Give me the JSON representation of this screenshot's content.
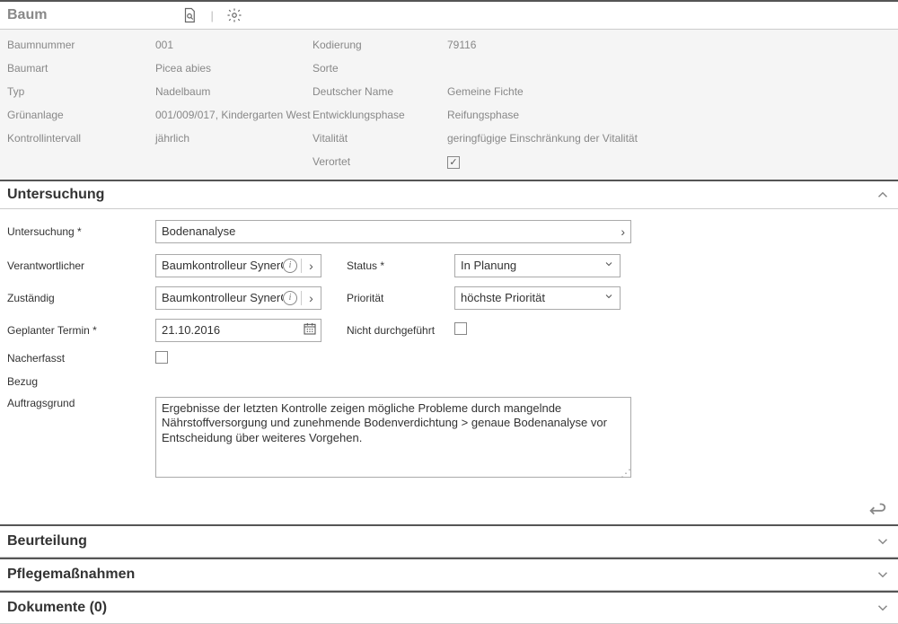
{
  "baum": {
    "title": "Baum",
    "fields": {
      "baumnummer_label": "Baumnummer",
      "baumnummer_value": "001",
      "kodierung_label": "Kodierung",
      "kodierung_value": "79116",
      "baumart_label": "Baumart",
      "baumart_value": "Picea abies",
      "sorte_label": "Sorte",
      "sorte_value": "",
      "typ_label": "Typ",
      "typ_value": "Nadelbaum",
      "deutscher_label": "Deutscher Name",
      "deutscher_value": "Gemeine Fichte",
      "gruenanlage_label": "Grünanlage",
      "gruenanlage_value": "001/009/017, Kindergarten West",
      "entwicklung_label": "Entwicklungsphase",
      "entwicklung_value": "Reifungsphase",
      "kontroll_label": "Kontrollintervall",
      "kontroll_value": "jährlich",
      "vitalitaet_label": "Vitalität",
      "vitalitaet_value": "geringfügige Einschränkung der Vitalität",
      "verortet_label": "Verortet"
    }
  },
  "untersuchung": {
    "title": "Untersuchung",
    "untersuchung_label": "Untersuchung *",
    "untersuchung_value": "Bodenanalyse",
    "verantwortlicher_label": "Verantwortlicher",
    "verantwortlicher_value": "Baumkontrolleur SynerGIS",
    "status_label": "Status *",
    "status_value": "In Planung",
    "zustaendig_label": "Zuständig",
    "zustaendig_value": "Baumkontrolleur SynerGIS",
    "prioritaet_label": "Priorität",
    "prioritaet_value": "höchste Priorität",
    "termin_label": "Geplanter Termin *",
    "termin_value": "21.10.2016",
    "nicht_durchgefuehrt_label": "Nicht durchgeführt",
    "nacherfasst_label": "Nacherfasst",
    "bezug_label": "Bezug",
    "auftragsgrund_label": "Auftragsgrund",
    "auftragsgrund_value": "Ergebnisse der letzten Kontrolle zeigen mögliche Probleme durch mangelnde Nährstoffversorgung und zunehmende Bodenverdichtung > genaue Bodenanalyse vor Entscheidung über weiteres Vorgehen."
  },
  "sections": {
    "beurteilung": "Beurteilung",
    "pflegemassnahmen": "Pflegemaßnahmen",
    "dokumente": "Dokumente (0)"
  }
}
